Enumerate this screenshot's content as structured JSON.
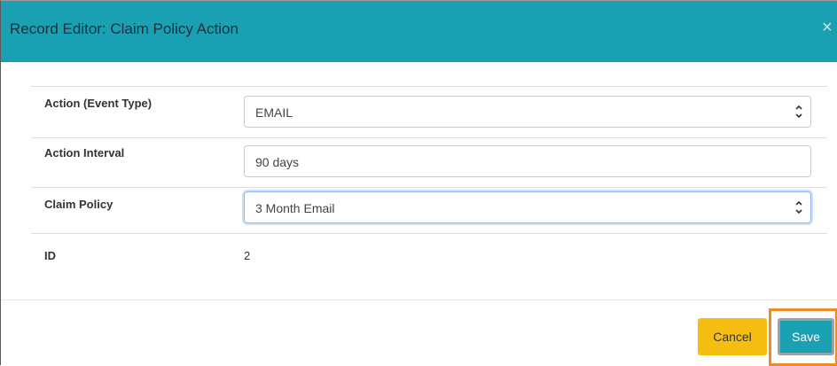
{
  "dialog": {
    "title": "Record Editor: Claim Policy Action",
    "close_glyph": "×"
  },
  "form": {
    "rows": [
      {
        "label": "Action (Event Type)",
        "value": "EMAIL",
        "control": "select"
      },
      {
        "label": "Action Interval",
        "value": "90 days",
        "control": "input"
      },
      {
        "label": "Claim Policy",
        "value": "3 Month Email",
        "control": "select",
        "focused": true
      },
      {
        "label": "ID",
        "value": "2",
        "control": "text"
      }
    ]
  },
  "footer": {
    "cancel_label": "Cancel",
    "save_label": "Save"
  },
  "colors": {
    "header_bg": "#1aa0b3",
    "cancel_bg": "#f6be11",
    "save_bg": "#1aa0b3",
    "highlight": "#f08a24"
  },
  "icons": {
    "close": "close-icon",
    "spinner": "up-down-chevron-icon"
  }
}
